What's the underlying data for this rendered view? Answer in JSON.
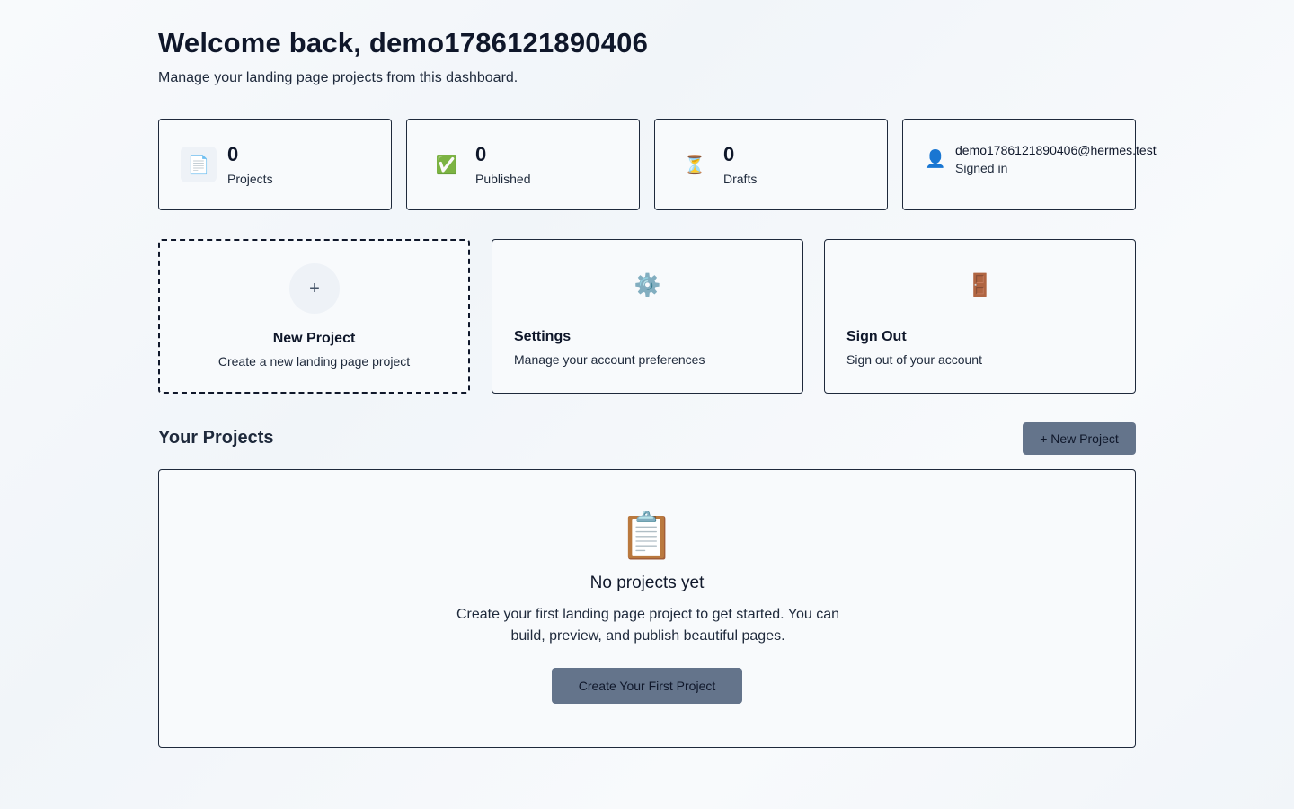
{
  "header": {
    "title": "Welcome back, demo1786121890406",
    "subtitle": "Manage your landing page projects from this dashboard."
  },
  "stats": [
    {
      "icon": "document-icon",
      "glyph": "📄",
      "value": "0",
      "label": "Projects"
    },
    {
      "icon": "check-icon",
      "glyph": "✅",
      "value": "0",
      "label": "Published"
    },
    {
      "icon": "hourglass-icon",
      "glyph": "⏳",
      "value": "0",
      "label": "Drafts"
    }
  ],
  "account": {
    "icon": "user-icon",
    "glyph": "👤",
    "email": "demo1786121890406@hermes.test",
    "status": "Signed in"
  },
  "actions": {
    "new_project": {
      "glyph": "+",
      "title": "New Project",
      "description": "Create a new landing page project"
    },
    "settings": {
      "glyph": "⚙️",
      "title": "Settings",
      "description": "Manage your account preferences"
    },
    "sign_out": {
      "glyph": "🚪",
      "title": "Sign Out",
      "description": "Sign out of your account"
    }
  },
  "projects": {
    "section_title": "Your Projects",
    "new_button_label": "+ New Project",
    "empty": {
      "glyph": "📋",
      "title": "No projects yet",
      "text": "Create your first landing page project to get started. You can build, preview, and publish beautiful pages.",
      "cta_label": "Create Your First Project"
    }
  },
  "colors": {
    "button_bg": "#64748b",
    "border": "#1e293b",
    "page_bg": "#f8fafc"
  }
}
